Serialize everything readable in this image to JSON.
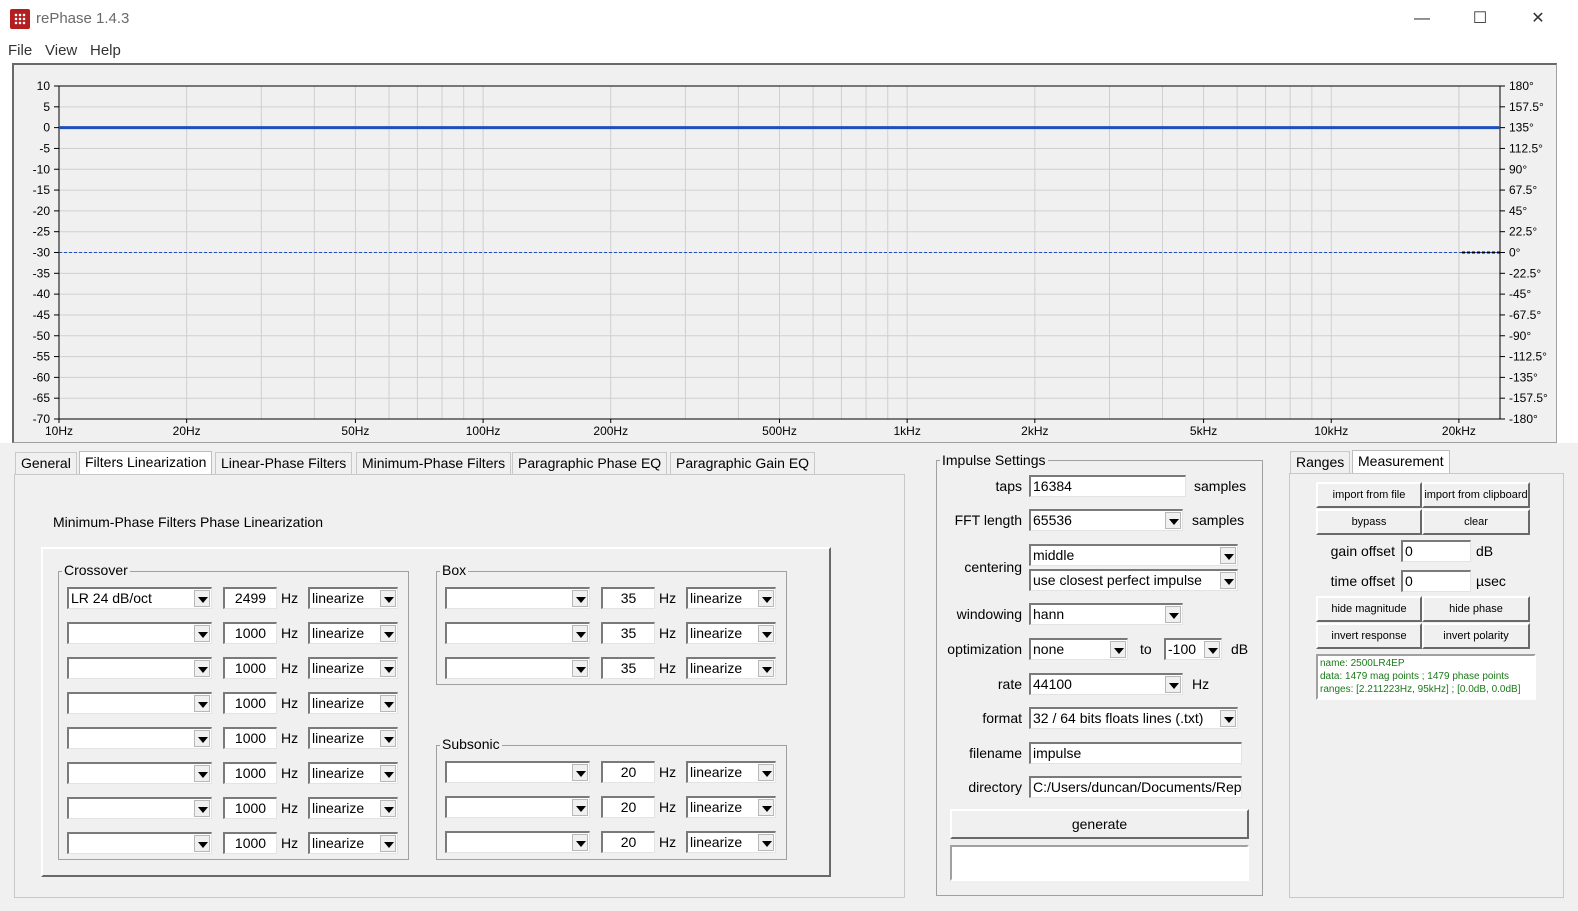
{
  "window": {
    "title": "rePhase 1.4.3",
    "minimize": "—",
    "maximize": "☐",
    "close": "✕"
  },
  "menu": [
    "File",
    "View",
    "Help"
  ],
  "plot": {
    "magnitude_ticks": [
      "10",
      "5",
      "0",
      "-5",
      "-10",
      "-15",
      "-20",
      "-25",
      "-30",
      "-35",
      "-40",
      "-45",
      "-50",
      "-55",
      "-60",
      "-65",
      "-70"
    ],
    "phase_ticks": [
      "180°",
      "157.5°",
      "135°",
      "112.5°",
      "90°",
      "67.5°",
      "45°",
      "22.5°",
      "0°",
      "-22.5°",
      "-45°",
      "-67.5°",
      "-90°",
      "-112.5°",
      "-135°",
      "-157.5°",
      "-180°"
    ],
    "freq_ticks": [
      {
        "label": "10Hz",
        "f": 10
      },
      {
        "label": "20Hz",
        "f": 20
      },
      {
        "label": "50Hz",
        "f": 50
      },
      {
        "label": "100Hz",
        "f": 100
      },
      {
        "label": "200Hz",
        "f": 200
      },
      {
        "label": "500Hz",
        "f": 500
      },
      {
        "label": "1kHz",
        "f": 1000
      },
      {
        "label": "2kHz",
        "f": 2000
      },
      {
        "label": "5kHz",
        "f": 5000
      },
      {
        "label": "10kHz",
        "f": 10000
      },
      {
        "label": "20kHz",
        "f": 20000
      }
    ],
    "magnitude_db": 0,
    "phase_deg": 0,
    "magnitude_color": "#1f4fbf",
    "phase_color": "#1f4fbf"
  },
  "tabs": [
    {
      "label": "General",
      "active": false
    },
    {
      "label": "Filters Linearization",
      "active": true
    },
    {
      "label": "Linear-Phase Filters",
      "active": false
    },
    {
      "label": "Minimum-Phase Filters",
      "active": false
    },
    {
      "label": "Paragraphic Phase EQ",
      "active": false
    },
    {
      "label": "Paragraphic Gain EQ",
      "active": false
    }
  ],
  "linearization": {
    "title": "Minimum-Phase Filters Phase Linearization",
    "crossover": {
      "label": "Crossover",
      "rows": [
        {
          "type": "LR  24 dB/oct",
          "freq": "2499",
          "unit": "Hz",
          "mode": "linearize"
        },
        {
          "type": "",
          "freq": "1000",
          "unit": "Hz",
          "mode": "linearize"
        },
        {
          "type": "",
          "freq": "1000",
          "unit": "Hz",
          "mode": "linearize"
        },
        {
          "type": "",
          "freq": "1000",
          "unit": "Hz",
          "mode": "linearize"
        },
        {
          "type": "",
          "freq": "1000",
          "unit": "Hz",
          "mode": "linearize"
        },
        {
          "type": "",
          "freq": "1000",
          "unit": "Hz",
          "mode": "linearize"
        },
        {
          "type": "",
          "freq": "1000",
          "unit": "Hz",
          "mode": "linearize"
        },
        {
          "type": "",
          "freq": "1000",
          "unit": "Hz",
          "mode": "linearize"
        }
      ]
    },
    "box": {
      "label": "Box",
      "rows": [
        {
          "type": "",
          "freq": "35",
          "unit": "Hz",
          "mode": "linearize"
        },
        {
          "type": "",
          "freq": "35",
          "unit": "Hz",
          "mode": "linearize"
        },
        {
          "type": "",
          "freq": "35",
          "unit": "Hz",
          "mode": "linearize"
        }
      ]
    },
    "subsonic": {
      "label": "Subsonic",
      "rows": [
        {
          "type": "",
          "freq": "20",
          "unit": "Hz",
          "mode": "linearize"
        },
        {
          "type": "",
          "freq": "20",
          "unit": "Hz",
          "mode": "linearize"
        },
        {
          "type": "",
          "freq": "20",
          "unit": "Hz",
          "mode": "linearize"
        }
      ]
    }
  },
  "impulse": {
    "title": "Impulse Settings",
    "taps_label": "taps",
    "taps": "16384",
    "taps_unit": "samples",
    "fft_label": "FFT length",
    "fft": "65536",
    "fft_unit": "samples",
    "centering_label": "centering",
    "centering": "middle",
    "centering2": "use closest perfect impulse",
    "windowing_label": "windowing",
    "windowing": "hann",
    "optimization_label": "optimization",
    "optimization": "none",
    "to_label": "to",
    "opt_db": "-100",
    "db_unit": "dB",
    "rate_label": "rate",
    "rate": "44100",
    "rate_unit": "Hz",
    "format_label": "format",
    "format": "32 / 64 bits floats lines (.txt)",
    "filename_label": "filename",
    "filename": "impulse",
    "directory_label": "directory",
    "directory": "C:/Users/duncan/Documents/Rep",
    "generate": "generate"
  },
  "measurement": {
    "tabs": [
      {
        "label": "Ranges",
        "active": false
      },
      {
        "label": "Measurement",
        "active": true
      }
    ],
    "import_file": "import from file",
    "import_clipboard": "import from clipboard",
    "bypass": "bypass",
    "clear": "clear",
    "gain_label": "gain offset",
    "gain": "0",
    "gain_unit": "dB",
    "time_label": "time offset",
    "time": "0",
    "time_unit": "µsec",
    "hide_magnitude": "hide magnitude",
    "hide_phase": "hide phase",
    "invert_response": "invert response",
    "invert_polarity": "invert polarity",
    "info": [
      "name: 2500LR4EP",
      "data: 1479 mag points ; 1479 phase points",
      "ranges: [2.211223Hz, 95kHz] ; [0.0dB, 0.0dB]"
    ]
  }
}
